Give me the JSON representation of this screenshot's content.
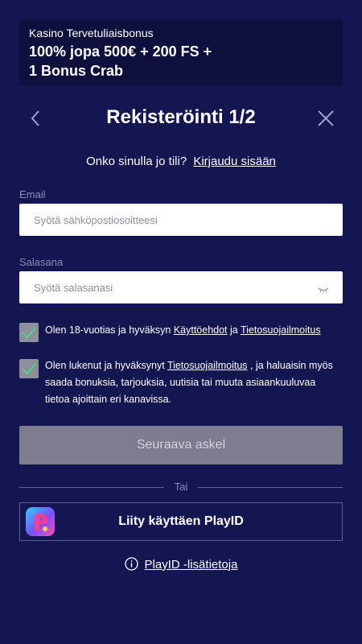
{
  "banner": {
    "subtitle": "Kasino Tervetuliaisbonus",
    "title_line1": "100% jopa 500€ + 200 FS +",
    "title_line2": "1 Bonus Crab"
  },
  "header": {
    "title": "Rekisteröinti 1/2",
    "back_icon": "chevron-left-icon",
    "close_icon": "close-icon"
  },
  "login_prompt": {
    "question": "Onko sinulla jo tili?",
    "link": "Kirjaudu sisään"
  },
  "email": {
    "label": "Email",
    "placeholder": "Syötä sähköpostiosoitteesi",
    "value": ""
  },
  "password": {
    "label": "Salasana",
    "placeholder": "Syötä salasanasi",
    "value": "",
    "toggle_icon": "eye-closed-icon"
  },
  "consents": [
    {
      "checked": true,
      "text_before": "Olen 18-vuotias ja hyväksyn ",
      "link1": "Käyttöehdot",
      "text_mid": " ja ",
      "link2": "Tietosuojailmoitus"
    },
    {
      "checked": true,
      "text_before": "Olen lukenut ja hyväksynyt ",
      "link1": "Tietosuojailmoitus",
      "text_after": " , ja haluaisin myös saada bonuksia, tarjouksia, uutisia tai muuta asiaankuuluvaa tietoa ajoittain eri kanavissa."
    }
  ],
  "submit_label": "Seuraava askel",
  "divider_text": "Tai",
  "playid": {
    "label": "Liity käyttäen PlayID",
    "logo": "playid-logo"
  },
  "info": {
    "icon": "info-icon",
    "label": "PlayID -lisätietoja"
  },
  "colors": {
    "background": "#131650",
    "banner_bg": "#0d0f3d",
    "checkbox": "#8e8e9c",
    "checkmark": "#4fd68a",
    "button_disabled": "#7d7b8e"
  }
}
